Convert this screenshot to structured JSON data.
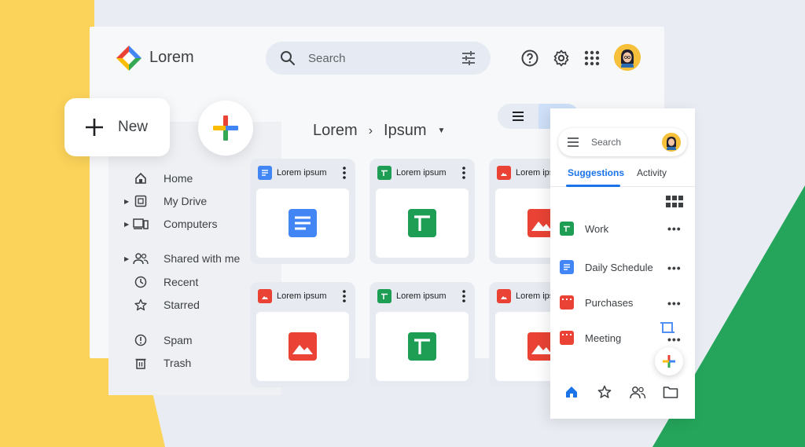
{
  "app": {
    "name": "Lorem"
  },
  "search": {
    "placeholder": "Search"
  },
  "sidebar": {
    "new_label": "New",
    "items": [
      {
        "label": "Home"
      },
      {
        "label": "My Drive"
      },
      {
        "label": "Computers"
      },
      {
        "label": "Shared with me"
      },
      {
        "label": "Recent"
      },
      {
        "label": "Starred"
      },
      {
        "label": "Spam"
      },
      {
        "label": "Trash"
      }
    ]
  },
  "breadcrumb": {
    "root": "Lorem",
    "current": "Ipsum"
  },
  "files": [
    {
      "name": "Lorem ipsum",
      "type": "doc"
    },
    {
      "name": "Lorem ipsum",
      "type": "sheet"
    },
    {
      "name": "Lorem ips",
      "type": "image"
    },
    {
      "name": "Lorem ipsum",
      "type": "image"
    },
    {
      "name": "Lorem ipsum",
      "type": "sheet"
    },
    {
      "name": "Lorem ips",
      "type": "image"
    }
  ],
  "panel": {
    "search_placeholder": "Search",
    "tabs": [
      {
        "label": "Suggestions"
      },
      {
        "label": "Activity"
      }
    ],
    "items": [
      {
        "label": "Work",
        "type": "sheet"
      },
      {
        "label": "Daily Schedule",
        "type": "doc"
      },
      {
        "label": "Purchases",
        "type": "slides"
      },
      {
        "label": "Meeting",
        "type": "slides"
      }
    ]
  },
  "colors": {
    "blue": "#4285F4",
    "green": "#1E9E54",
    "red": "#EA4335",
    "yellow": "#F8C93E",
    "accent": "#1A73E8"
  }
}
